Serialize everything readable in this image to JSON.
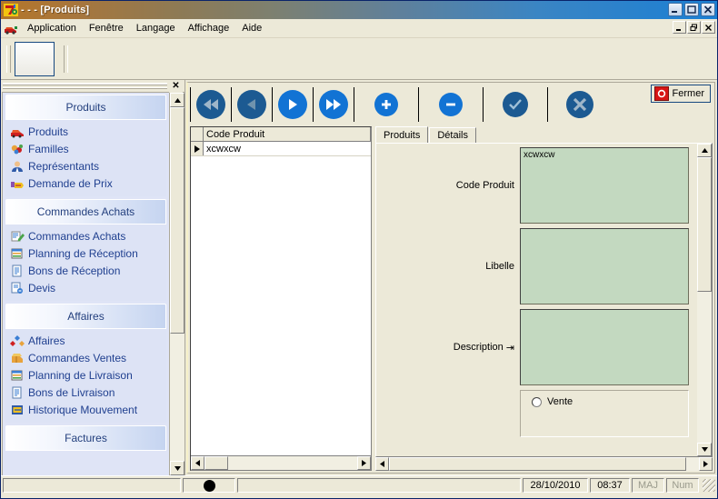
{
  "window": {
    "title": "- - - [Produits]",
    "icon": "app-icon",
    "buttons": {
      "minimize": "_",
      "maximize": "□",
      "close": "✕"
    }
  },
  "menubar": {
    "icon": "app-small-icon",
    "items": [
      {
        "label": "Application",
        "accel": "A"
      },
      {
        "label": "Fenêtre",
        "accel": "ê"
      },
      {
        "label": "Langage",
        "accel": "L"
      },
      {
        "label": "Affichage",
        "accel": "f"
      },
      {
        "label": "Aide",
        "accel": "i"
      }
    ],
    "mdi_buttons": {
      "minimize": "_",
      "restore": "❐",
      "close": "✕"
    }
  },
  "sidebar": {
    "close_label": "✕",
    "groups": [
      {
        "header": "Produits",
        "items": [
          {
            "label": "Produits",
            "icon": "car-icon"
          },
          {
            "label": "Familles",
            "icon": "families-icon"
          },
          {
            "label": "Représentants",
            "icon": "person-icon"
          },
          {
            "label": "Demande de Prix",
            "icon": "price-request-icon"
          }
        ]
      },
      {
        "header": "Commandes Achats",
        "items": [
          {
            "label": "Commandes Achats",
            "icon": "purchase-order-icon"
          },
          {
            "label": "Planning de Réception",
            "icon": "planning-icon"
          },
          {
            "label": "Bons de Réception",
            "icon": "document-icon"
          },
          {
            "label": "Devis",
            "icon": "quote-icon"
          }
        ]
      },
      {
        "header": "Affaires",
        "items": [
          {
            "label": "Affaires",
            "icon": "business-icon"
          },
          {
            "label": "Commandes Ventes",
            "icon": "sales-order-icon"
          },
          {
            "label": "Planning de Livraison",
            "icon": "planning-icon"
          },
          {
            "label": "Bons de Livraison",
            "icon": "document-icon"
          },
          {
            "label": "Historique Mouvement",
            "icon": "history-icon"
          }
        ]
      },
      {
        "header": "Factures",
        "items": []
      }
    ],
    "scroll": {
      "up": "▲",
      "down": "▼"
    }
  },
  "toolbar": {
    "nav": [
      {
        "name": "first-record",
        "icon": "skip-back",
        "state": "disabled"
      },
      {
        "name": "previous-record",
        "icon": "play-back",
        "state": "disabled"
      },
      {
        "name": "next-record",
        "icon": "play-forward",
        "state": "enabled"
      },
      {
        "name": "last-record",
        "icon": "skip-forward",
        "state": "enabled"
      }
    ],
    "add": {
      "name": "add-record",
      "icon": "plus",
      "state": "enabled"
    },
    "delete": {
      "name": "delete-record",
      "icon": "minus",
      "state": "enabled"
    },
    "validate": {
      "name": "validate-record",
      "icon": "check",
      "state": "disabled"
    },
    "cancel": {
      "name": "cancel-record",
      "icon": "cross",
      "state": "disabled"
    },
    "close_button": {
      "label": "Fermer",
      "accel": "F",
      "icon": "stop-icon"
    }
  },
  "grid": {
    "columns": [
      "Code Produit"
    ],
    "rows": [
      {
        "indicator": "▶",
        "Code Produit": "xcwxcw"
      }
    ],
    "hscroll": {
      "left": "◀",
      "right": "▶"
    }
  },
  "detail": {
    "tabs": [
      {
        "label": "Produits",
        "active": true
      },
      {
        "label": "Détails",
        "active": false
      }
    ],
    "fields": [
      {
        "label": "Code Produit",
        "value": "xcwxcw",
        "arrow": ""
      },
      {
        "label": "Libelle",
        "value": "",
        "arrow": ""
      },
      {
        "label": "Description",
        "value": "",
        "arrow": "⇥"
      }
    ],
    "radio_group": [
      {
        "label": "Vente",
        "checked": false
      }
    ],
    "scroll": {
      "up": "▲",
      "down": "▼",
      "left": "◀",
      "right": "▶"
    }
  },
  "statusbar": {
    "indicator": "record-dot",
    "message": "",
    "date": "28/10/2010",
    "time": "08:37",
    "maj": "MAJ",
    "num": "Num"
  },
  "colors": {
    "title_start": "#b4762a",
    "title_end": "#1b7fd4",
    "face": "#ece9d8",
    "sidebar_bg": "#dde3f5",
    "sidebar_text": "#1f3f8f",
    "field_green": "#c3d9c0",
    "accent_blue": "#1273d4",
    "accent_dark": "#1c5a92",
    "stop_red": "#d81515"
  }
}
